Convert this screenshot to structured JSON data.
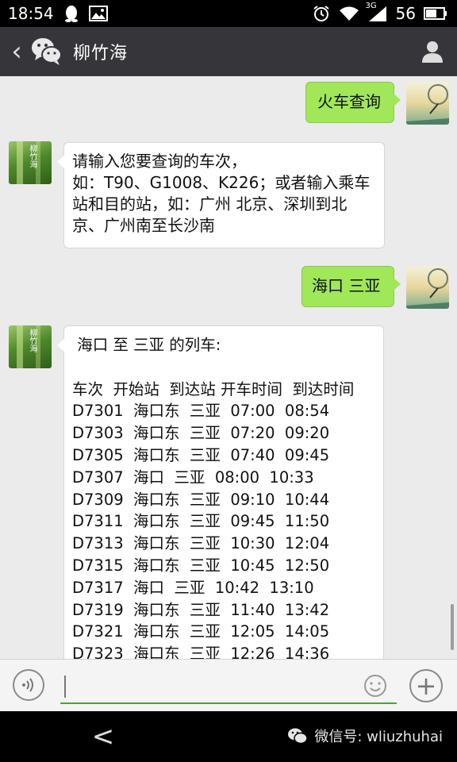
{
  "status_bar": {
    "time": "18:54",
    "signal_label": "3G",
    "battery": "56"
  },
  "title_bar": {
    "back_symbol": "‹",
    "title": "柳竹海"
  },
  "avatars": {
    "bot_text": "柳竹海"
  },
  "messages": {
    "m1_text": "火车查询",
    "m2_lines": [
      "请输入您要查询的车次，",
      "如：T90、G1008、K226；或者输入乘车",
      "站和目的站，如：广州 北京、深圳到北",
      "京、广州南至长沙南"
    ],
    "m3_text": "海口 三亚",
    "m4_title": " 海口 至 三亚 的列车:",
    "m4_header": "车次  开始站  到达站 开车时间  到达时间",
    "m4_rows": [
      "D7301  海口东  三亚  07:00  08:54",
      "D7303  海口东  三亚  07:20  09:20",
      "D7305  海口东  三亚  07:40  09:45",
      "D7307  海口  三亚  08:00  10:33",
      "D7309  海口东  三亚  09:10  10:44",
      "D7311  海口东  三亚  09:45  11:50",
      "D7313  海口东  三亚  10:30  12:04",
      "D7315  海口东  三亚  10:45  12:50",
      "D7317  海口  三亚  10:42  13:10",
      "D7319  海口东  三亚  11:40  13:42",
      "D7321  海口东  三亚  12:05  14:05",
      "D7323  海口东  三亚  12:26  14:36"
    ]
  },
  "input_bar": {
    "value": "",
    "plus_symbol": "+"
  },
  "nav_bar": {
    "back_symbol": "<",
    "watermark": "微信号: wliuzhuhai"
  },
  "icons": [
    "person-icon",
    "wechat-logo-icon",
    "wifi-icon",
    "alarm-icon",
    "battery-icon",
    "voice-icon",
    "emoji-icon",
    "plus-icon"
  ],
  "colors": {
    "outgoing_bubble": "#a0e75a",
    "incoming_bubble": "#ffffff",
    "title_bar": "#35353a",
    "input_underline": "#4aa52c"
  }
}
